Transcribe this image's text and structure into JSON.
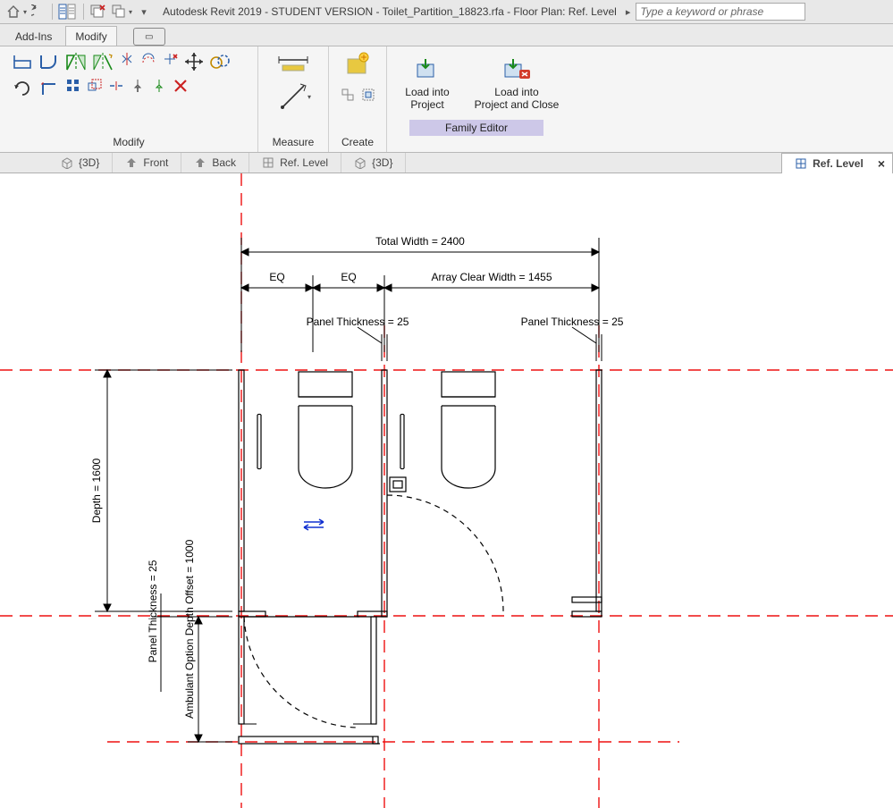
{
  "title": "Autodesk Revit 2019 - STUDENT VERSION - Toilet_Partition_18823.rfa - Floor Plan: Ref. Level",
  "search": {
    "placeholder": "Type a keyword or phrase"
  },
  "tabs": {
    "addins": "Add-Ins",
    "modify": "Modify"
  },
  "ribbon": {
    "modify": "Modify",
    "measure": "Measure",
    "create": "Create",
    "family_editor": "Family Editor",
    "load_project": "Load into\nProject",
    "load_close": "Load into\nProject and Close"
  },
  "viewtabs": {
    "v1": "{3D}",
    "v2": "Front",
    "v3": "Back",
    "v4": "Ref. Level",
    "v5": "{3D}",
    "v6": "Ref. Level"
  },
  "dims": {
    "total_width": "Total Width = 2400",
    "eq1": "EQ",
    "eq2": "EQ",
    "array_clear": "Array Clear Width = 1455",
    "panel_thk1": "Panel Thickness = 25",
    "panel_thk2": "Panel Thickness = 25",
    "depth": "Depth = 1600",
    "panel_thk_v": "Panel Thickness = 25",
    "amb_offset": "Ambulant Option Depth Offset = 1000"
  }
}
